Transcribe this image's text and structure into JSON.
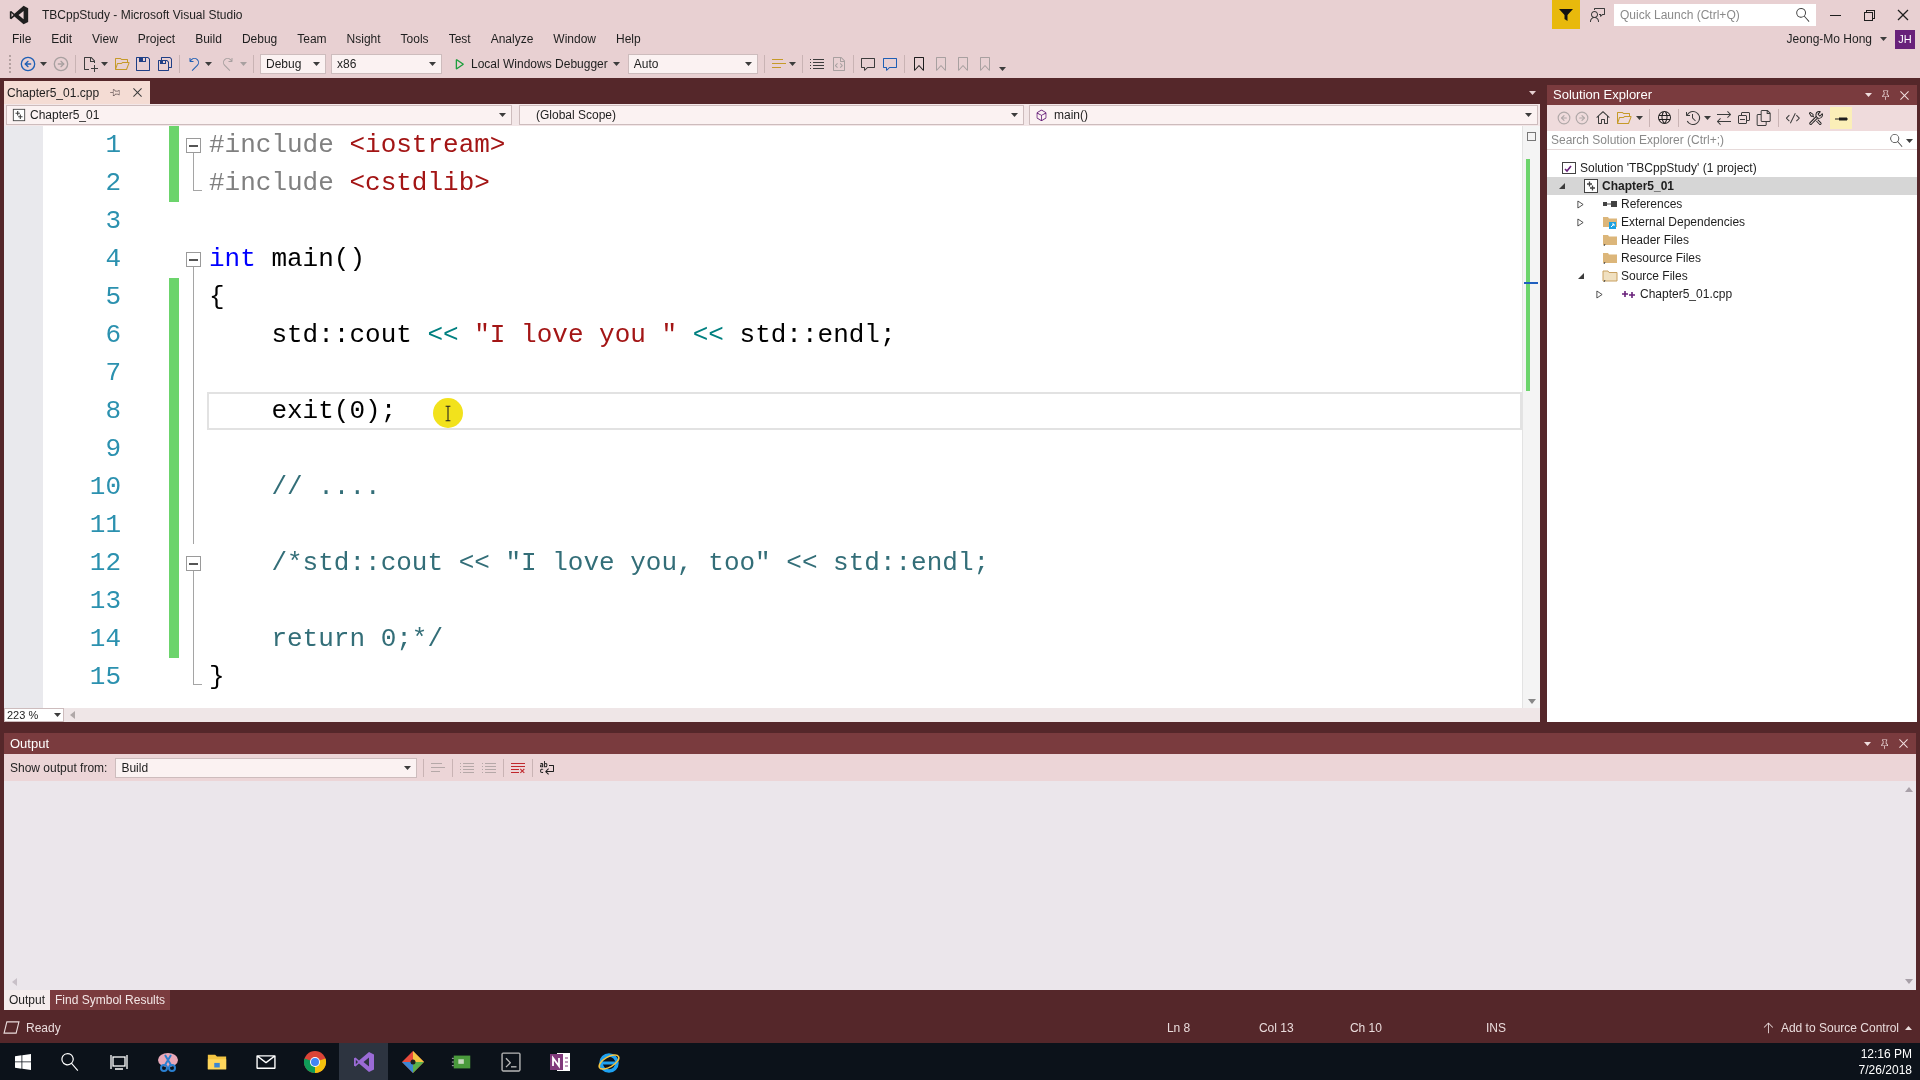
{
  "window": {
    "title": "TBCppStudy - Microsoft Visual Studio",
    "quick_launch": {
      "placeholder": "Quick Launch (Ctrl+Q)"
    },
    "user_name": "Jeong-Mo Hong",
    "user_initials": "JH"
  },
  "menu": [
    "File",
    "Edit",
    "View",
    "Project",
    "Build",
    "Debug",
    "Team",
    "Nsight",
    "Tools",
    "Test",
    "Analyze",
    "Window",
    "Help"
  ],
  "toolbar": {
    "configuration": "Debug",
    "platform": "x86",
    "debugger": "Local Windows Debugger",
    "debug_mode": "Auto"
  },
  "document_tabs": [
    {
      "label": "Chapter5_01.cpp",
      "selected": true
    }
  ],
  "navigation_bar": {
    "project": "Chapter5_01",
    "scope": "(Global Scope)",
    "member": "main()"
  },
  "editor": {
    "lines": [
      {
        "number": "1",
        "kind": "fold_start",
        "changed": true,
        "current": false,
        "tokens": [
          {
            "kind": "preprocessor",
            "text": "#include "
          },
          {
            "kind": "include_path",
            "text": "<iostream>"
          }
        ]
      },
      {
        "number": "2",
        "kind": "fold_end",
        "changed": true,
        "current": false,
        "tokens": [
          {
            "kind": "preprocessor",
            "text": "#include "
          },
          {
            "kind": "include_path",
            "text": "<cstdlib>"
          }
        ]
      },
      {
        "number": "3",
        "kind": "plain",
        "changed": false,
        "current": false
      },
      {
        "number": "4",
        "kind": "fold_start",
        "changed": false,
        "current": false,
        "tokens": [
          {
            "kind": "keyword",
            "text": "int"
          },
          {
            "kind": "plain",
            "text": " main()"
          }
        ]
      },
      {
        "number": "5",
        "kind": "fold_inside",
        "changed": true,
        "current": false,
        "tokens": [
          {
            "kind": "plain",
            "text": "{"
          }
        ]
      },
      {
        "number": "6",
        "kind": "fold_inside",
        "changed": true,
        "current": false,
        "tokens": [
          {
            "kind": "plain",
            "text": "    std::cout"
          },
          {
            "kind": "operator",
            "text": " << "
          },
          {
            "kind": "string",
            "text": "\"I love you \""
          },
          {
            "kind": "operator",
            "text": " << "
          },
          {
            "kind": "plain",
            "text": "std::endl;"
          }
        ]
      },
      {
        "number": "7",
        "kind": "fold_inside",
        "changed": true,
        "current": false
      },
      {
        "number": "8",
        "kind": "fold_inside",
        "changed": true,
        "current": true,
        "tokens": [
          {
            "kind": "plain",
            "text": "    exit(0);"
          }
        ]
      },
      {
        "number": "9",
        "kind": "fold_inside",
        "changed": true,
        "current": false
      },
      {
        "number": "10",
        "kind": "fold_inside",
        "changed": true,
        "current": false,
        "tokens": [
          {
            "kind": "comment",
            "text": "    // ...."
          }
        ]
      },
      {
        "number": "11",
        "kind": "fold_inside",
        "changed": true,
        "current": false
      },
      {
        "number": "12",
        "kind": "fold_start",
        "changed": true,
        "current": false,
        "tokens": [
          {
            "kind": "comment",
            "text": "    /*std::cout << \"I love you, too\" << std::endl;"
          }
        ]
      },
      {
        "number": "13",
        "kind": "fold_inside",
        "changed": true,
        "current": false
      },
      {
        "number": "14",
        "kind": "fold_inside",
        "changed": true,
        "current": false,
        "tokens": [
          {
            "kind": "comment",
            "text": "    return 0;*/"
          }
        ]
      },
      {
        "number": "15",
        "kind": "fold_end",
        "changed": false,
        "current": false,
        "tokens": [
          {
            "kind": "plain",
            "text": "}"
          }
        ]
      }
    ],
    "zoom": "223 %"
  },
  "solution_explorer": {
    "title": "Solution Explorer",
    "search": {
      "placeholder": "Search Solution Explorer (Ctrl+;)"
    },
    "tree": [
      {
        "label": "Solution 'TBCppStudy' (1 project)",
        "kind": "solution",
        "selected": false,
        "children": [
          {
            "label": "Chapter5_01",
            "kind": "project",
            "selected": true,
            "expanded": true,
            "children": [
              {
                "label": "References",
                "kind": "references",
                "selected": false,
                "expanded": false
              },
              {
                "label": "External Dependencies",
                "kind": "external",
                "selected": false,
                "expanded": false
              },
              {
                "label": "Header Files",
                "kind": "folder",
                "selected": false
              },
              {
                "label": "Resource Files",
                "kind": "folder",
                "selected": false
              },
              {
                "label": "Source Files",
                "kind": "folder_open",
                "selected": false,
                "expanded": true,
                "children": [
                  {
                    "label": "Chapter5_01.cpp",
                    "kind": "cpp",
                    "selected": false,
                    "expanded": false
                  }
                ]
              }
            ]
          }
        ]
      }
    ]
  },
  "output": {
    "title": "Output",
    "show_from_label": "Show output from:",
    "source": "Build"
  },
  "bottom_tabs": [
    {
      "label": "Output",
      "selected": true
    },
    {
      "label": "Find Symbol Results",
      "selected": false
    }
  ],
  "status_bar": {
    "state": "Ready",
    "line": "Ln 8",
    "column": "Col 13",
    "char": "Ch 10",
    "mode": "INS",
    "source_control": "Add to Source Control"
  },
  "taskbar": {
    "time": "12:16 PM",
    "date": "7/26/2018"
  }
}
